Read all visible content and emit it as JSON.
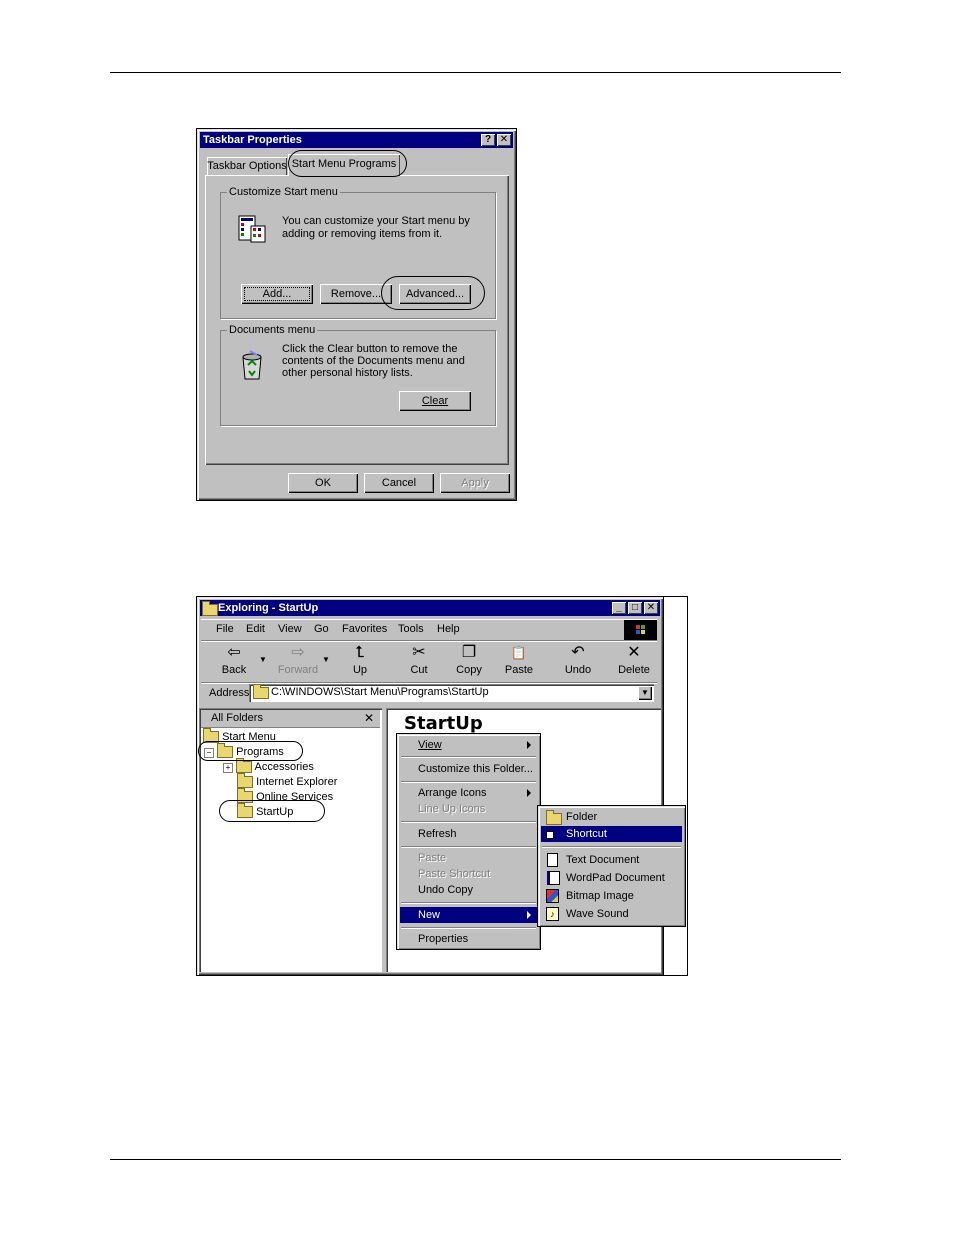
{
  "taskbar": {
    "title": "Taskbar Properties",
    "help_btn": "?",
    "close_btn": "✕",
    "tabs": [
      "Taskbar Options",
      "Start Menu Programs"
    ],
    "customize_group": "Customize Start menu",
    "customize_text_1": "You can customize your Start menu by",
    "customize_text_2": "adding or removing items from it.",
    "add": "Add...",
    "remove": "Remove...",
    "advanced": "Advanced...",
    "documents_group": "Documents menu",
    "documents_text_1": "Click the Clear button to remove the",
    "documents_text_2": "contents of the Documents menu and",
    "documents_text_3": "other personal history lists.",
    "clear": "Clear",
    "ok": "OK",
    "cancel": "Cancel",
    "apply": "Apply"
  },
  "explorer": {
    "title": "Exploring - StartUp",
    "menu": [
      "File",
      "Edit",
      "View",
      "Go",
      "Favorites",
      "Tools",
      "Help"
    ],
    "toolbar": [
      {
        "label": "Back",
        "icon": "back-arrow-icon",
        "glyph": "⇦",
        "disabled": false
      },
      {
        "label": "Forward",
        "icon": "forward-arrow-icon",
        "glyph": "⇨",
        "disabled": true
      },
      {
        "label": "Up",
        "icon": "up-folder-icon",
        "glyph": "⮤",
        "disabled": false
      },
      {
        "label": "Cut",
        "icon": "scissors-icon",
        "glyph": "✂",
        "disabled": false
      },
      {
        "label": "Copy",
        "icon": "copy-icon",
        "glyph": "❐",
        "disabled": false
      },
      {
        "label": "Paste",
        "icon": "paste-icon",
        "glyph": "📋",
        "disabled": false
      },
      {
        "label": "Undo",
        "icon": "undo-icon",
        "glyph": "↶",
        "disabled": false
      },
      {
        "label": "Delete",
        "icon": "delete-x-icon",
        "glyph": "✕",
        "disabled": false
      }
    ],
    "address_label": "Address",
    "address_value": "C:\\WINDOWS\\Start Menu\\Programs\\StartUp",
    "all_folders": "All Folders",
    "tree": [
      "Start Menu",
      "Programs",
      "Accessories",
      "Internet Explorer",
      "Online Services",
      "StartUp"
    ],
    "folder_heading": "StartUp",
    "context_menu": [
      {
        "label": "View",
        "disabled": false,
        "submenu": true
      },
      {
        "label": "Customize this Folder...",
        "disabled": false
      },
      {
        "label": "Arrange Icons",
        "disabled": false,
        "submenu": true
      },
      {
        "label": "Line Up Icons",
        "disabled": true
      },
      {
        "label": "Refresh",
        "disabled": false
      },
      {
        "label": "Paste",
        "disabled": true
      },
      {
        "label": "Paste Shortcut",
        "disabled": true
      },
      {
        "label": "Undo Copy",
        "disabled": false
      },
      {
        "label": "New",
        "disabled": false,
        "submenu": true,
        "selected": true
      },
      {
        "label": "Properties",
        "disabled": false
      }
    ],
    "new_submenu": [
      "Folder",
      "Shortcut",
      "Text Document",
      "WordPad Document",
      "Bitmap Image",
      "Wave Sound"
    ]
  }
}
